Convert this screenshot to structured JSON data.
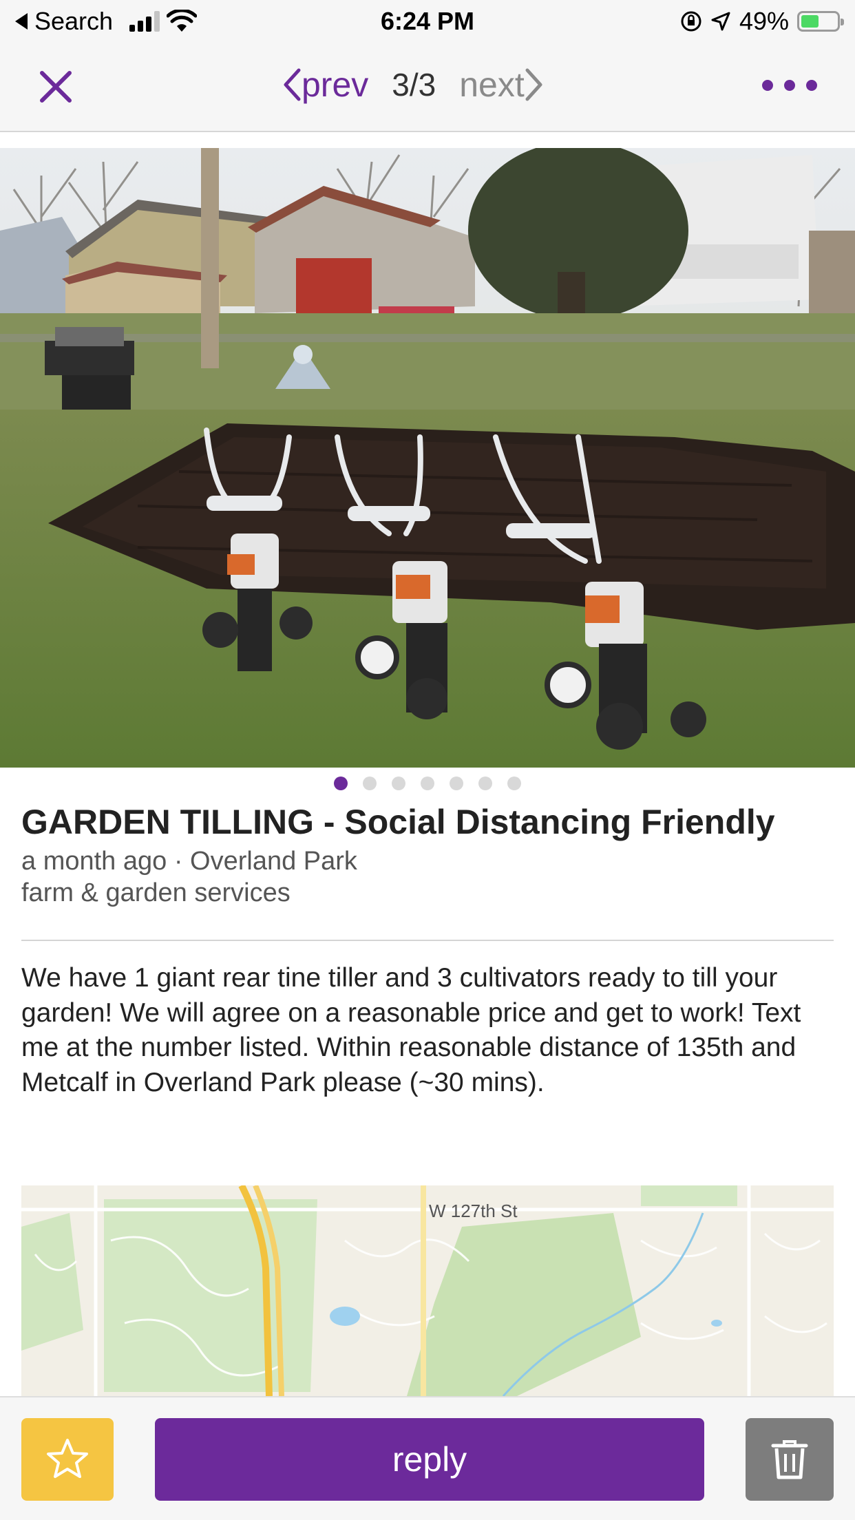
{
  "status_bar": {
    "back_label": "Search",
    "time": "6:24 PM",
    "battery": "49%",
    "battery_level": 0.49,
    "signal_bars": 3
  },
  "nav": {
    "prev_label": "prev",
    "counter": "3/3",
    "next_label": "next"
  },
  "gallery": {
    "total_images": 7,
    "active_index": 0
  },
  "listing": {
    "title": "GARDEN TILLING - Social Distancing Friendly",
    "posted": "a month ago · Overland Park",
    "category": "farm & garden services",
    "body": "We have 1 giant rear tine tiller and 3 cultivators ready to till your garden! We will agree on a reasonable price and get to work! Text me at the number listed. Within reasonable distance of 135th and Metcalf in Overland Park please (~30 mins)."
  },
  "map": {
    "street_label": "W 127th St"
  },
  "bottom_bar": {
    "reply_label": "reply"
  },
  "colors": {
    "accent": "#6c2a9b",
    "star": "#f5c542",
    "trash": "#7d7d7d"
  },
  "icons": [
    "back-arrow-icon",
    "signal-icon",
    "wifi-icon",
    "orientation-lock-icon",
    "location-arrow-icon",
    "battery-icon",
    "close-icon",
    "chevron-left-icon",
    "chevron-right-icon",
    "more-icon",
    "star-icon",
    "trash-icon"
  ]
}
